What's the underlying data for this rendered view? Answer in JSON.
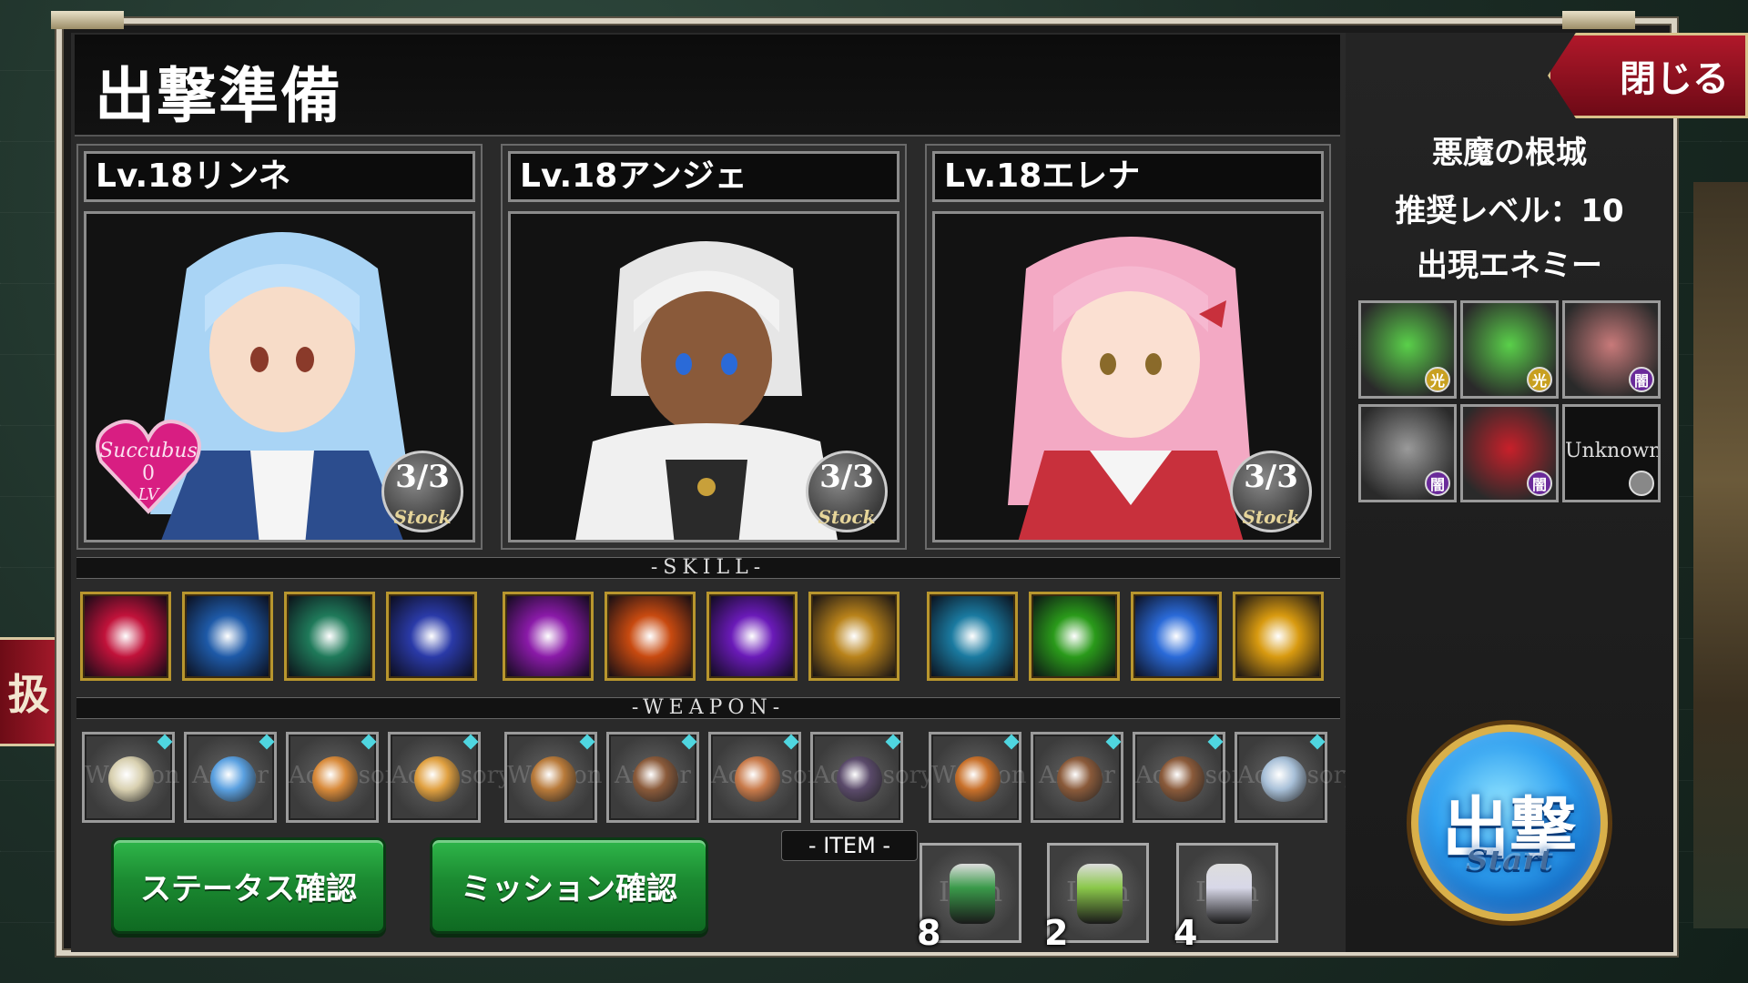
{
  "screen": {
    "title": "出撃準備",
    "close_label": "閉じる",
    "side_tab_label": "扱"
  },
  "characters": [
    {
      "name": "Lv.18リンネ",
      "stock": "3/3",
      "stock_label": "Stock",
      "badge": {
        "text1": "Succubus",
        "text2": "0",
        "text3": "LV"
      },
      "hair": "#a9d4f5",
      "outfit": "#2c4d8e"
    },
    {
      "name": "Lv.18アンジェ",
      "stock": "3/3",
      "stock_label": "Stock",
      "hair": "#e6e6e6",
      "outfit": "#f0f0f0"
    },
    {
      "name": "Lv.18エレナ",
      "stock": "3/3",
      "stock_label": "Stock",
      "hair": "#f3a9c4",
      "outfit": "#c8303c"
    }
  ],
  "sections": {
    "skill_label": "-SKILL-",
    "weapon_label": "-WEAPON-",
    "item_label": "- ITEM -"
  },
  "skills": [
    {
      "icon": "slash-skill-icon",
      "color": "#c1123a"
    },
    {
      "icon": "wind-wave-skill-icon",
      "color": "#1e5aa8"
    },
    {
      "icon": "crystal-arrow-skill-icon",
      "color": "#1f7a5a"
    },
    {
      "icon": "aura-burst-skill-icon",
      "color": "#2a3aa8"
    },
    {
      "icon": "magic-circle-skill-icon",
      "color": "#8a1aa8"
    },
    {
      "icon": "fire-skill-icon",
      "color": "#c84a10"
    },
    {
      "icon": "dark-slash-skill-icon",
      "color": "#6a1ab8"
    },
    {
      "icon": "holy-book-skill-icon",
      "color": "#b8821a"
    },
    {
      "icon": "water-dance-skill-icon",
      "color": "#1a7aa0"
    },
    {
      "icon": "green-wind-skill-icon",
      "color": "#2a9a1a"
    },
    {
      "icon": "ice-comet-skill-icon",
      "color": "#2a6ad8"
    },
    {
      "icon": "light-burst-skill-icon",
      "color": "#d89a10"
    }
  ],
  "weapons": [
    {
      "icon": "sword-weapon-icon",
      "watermark": "Weapon",
      "color": "#d8d0b0"
    },
    {
      "icon": "jacket-armor-icon",
      "watermark": "Armor",
      "color": "#5aa0e0"
    },
    {
      "icon": "ring-accessory-icon",
      "watermark": "Accessory",
      "color": "#d88a3a"
    },
    {
      "icon": "ring-accessory-icon",
      "watermark": "Accessory",
      "color": "#e0a040"
    },
    {
      "icon": "staff-weapon-icon",
      "watermark": "Weapon",
      "color": "#b87a3a"
    },
    {
      "icon": "armor-icon",
      "watermark": "Armor",
      "color": "#8a5a3a"
    },
    {
      "icon": "necklace-accessory-icon",
      "watermark": "Accessory",
      "color": "#c87a4a"
    },
    {
      "icon": "necklace-accessory-icon",
      "watermark": "Accessory",
      "color": "#5a4a6a"
    },
    {
      "icon": "staff-weapon-icon",
      "watermark": "Weapon",
      "color": "#c8702a"
    },
    {
      "icon": "armor-icon",
      "watermark": "Armor",
      "color": "#8a5a3a"
    },
    {
      "icon": "necklace-accessory-icon",
      "watermark": "Accessory",
      "color": "#8a5a3a"
    },
    {
      "icon": "ring-accessory-icon",
      "watermark": "Accessory",
      "color": "#a8c0d8"
    }
  ],
  "buttons": {
    "status_label": "ステータス確認",
    "mission_label": "ミッション確認",
    "sortie_label": "出撃",
    "sortie_sub": "Start"
  },
  "items": [
    {
      "icon": "herb-item-icon",
      "count": "8",
      "watermark": "Item",
      "color": "#3a9a4a"
    },
    {
      "icon": "potion-jar-item-icon",
      "count": "2",
      "watermark": "Item",
      "color": "#8ac84a"
    },
    {
      "icon": "flask-item-icon",
      "count": "4",
      "watermark": "Item",
      "color": "#d8d8e8"
    }
  ],
  "stage": {
    "name": "悪魔の根城",
    "recommended_level": "推奨レベル：10",
    "enemies_label": "出現エネミー"
  },
  "enemies": [
    {
      "icon": "green-slime-frog-enemy-icon",
      "element": "光",
      "color": "#5ad04a",
      "badge_color": "#c8a020"
    },
    {
      "icon": "green-slime-frog-enemy-icon",
      "element": "光",
      "color": "#5ad04a",
      "badge_color": "#c8a020"
    },
    {
      "icon": "demon-girl-enemy-icon",
      "element": "闇",
      "color": "#c87a7a",
      "badge_color": "#6a2a9a"
    },
    {
      "icon": "skeleton-knight-enemy-icon",
      "element": "闇",
      "color": "#9a9a9a",
      "badge_color": "#6a2a9a"
    },
    {
      "icon": "red-demon-enemy-icon",
      "element": "闇",
      "color": "#c8202a",
      "badge_color": "#6a2a9a"
    },
    {
      "icon": "unknown-enemy-icon",
      "element": "",
      "label": "Unknown",
      "color": "#101010",
      "badge_color": "#888888"
    }
  ]
}
